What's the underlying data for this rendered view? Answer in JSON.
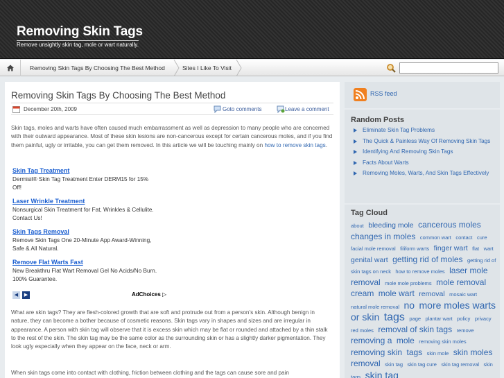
{
  "header": {
    "site_title": "Removing Skin Tags",
    "site_description": "Remove unsightly skin tag, mole or wart naturally."
  },
  "nav": {
    "home_icon": "home-icon",
    "items": [
      {
        "label": "Removing Skin Tags By Choosing The Best Method"
      },
      {
        "label": "Sites I Like To Visit"
      }
    ],
    "search_icon": "magnifier-icon",
    "search_value": ""
  },
  "post": {
    "title": "Removing Skin Tags By Choosing The Best Method",
    "date": "December 20th, 2009",
    "goto_comments": "Goto comments",
    "leave_comment": "Leave a comment",
    "intro_text": "Skin tags, moles and warts have often caused much embarrassment as well as depression to many people who are concerned with their outward appearance. Most of these skin lesions are non-cancerous except for certain cancerous moles, and if you find them painful, ugly or irritable, you can get them removed. In this article we will be touching mainly on",
    "intro_link": "how to remove skin tags",
    "intro_end": ".",
    "para2": "What are skin tags? They are flesh-colored growth that are soft and protrude out from a person’s skin. Although benign in nature, they can become a bother because of cosmetic reasons. Skin tags vary in shapes and sizes and are irregular in appearance. A person with skin tag will observe that it is excess skin which may be flat or rounded and attached by a thin stalk to the rest of the skin. The skin tag may be the same color as the surrounding skin or has a slightly darker pigmentation. They look ugly especially when they appear on the face, neck or arm.",
    "para3": "When skin tags come into contact with clothing, friction between clothing and the tags can cause sore and pain"
  },
  "ads": {
    "items": [
      {
        "title": "Skin Tag Treatment",
        "text": "Dermisil® Skin Tag Treatment Enter DERM15 for 15% Off!"
      },
      {
        "title": "Laser Wrinkle Treatment",
        "text": "Nonsurgical Skin Treatment for Fat, Wrinkles & Cellulite. Contact Us!"
      },
      {
        "title": "Skin Tags Removal",
        "text": "Remove Skin Tags One 20-Minute App Award-Winning, Safe & All Natural."
      },
      {
        "title": "Remove Flat Warts Fast",
        "text": "New Breakthru Flat Wart Removal Gel No Acids/No Burn. 100% Guarantee."
      }
    ],
    "adchoices_label": "AdChoices"
  },
  "sidebar": {
    "rss_label": "RSS feed",
    "random_posts_title": "Random Posts",
    "random_posts": [
      "Eliminate Skin Tag Problems",
      "The Quick & Painless Way Of Removing Skin Tags",
      "Identifying And Removing Skin Tags",
      "Facts About Warts",
      "Removing Moles, Warts, And Skin Tags Effectively"
    ],
    "tag_cloud_title": "Tag Cloud",
    "tags": [
      {
        "t": "about",
        "s": 1
      },
      {
        "t": "bleeding mole",
        "s": 3
      },
      {
        "t": "cancerous moles",
        "s": 4
      },
      {
        "t": "changes in moles",
        "s": 4
      },
      {
        "t": "common wart",
        "s": 1
      },
      {
        "t": "contact",
        "s": 1
      },
      {
        "t": "cure",
        "s": 1
      },
      {
        "t": "facial mole removal",
        "s": 1
      },
      {
        "t": "filiform warts",
        "s": 1
      },
      {
        "t": "finger wart",
        "s": 3
      },
      {
        "t": "flat",
        "s": 1
      },
      {
        "t": "wart",
        "s": 1
      },
      {
        "t": "genital wart",
        "s": 3
      },
      {
        "t": "getting rid of moles",
        "s": 4
      },
      {
        "t": "getting rid of skin tags on neck",
        "s": 1
      },
      {
        "t": "how to remove moles",
        "s": 1
      },
      {
        "t": "laser mole removal",
        "s": 4
      },
      {
        "t": "mole mole problems",
        "s": 1
      },
      {
        "t": "mole removal cream",
        "s": 4
      },
      {
        "t": "mole wart",
        "s": 4
      },
      {
        "t": "removal",
        "s": 3
      },
      {
        "t": "mosaic wart",
        "s": 1
      },
      {
        "t": "natural mole removal",
        "s": 1
      },
      {
        "t": "no",
        "s": 5
      },
      {
        "t": "more moles warts or skin",
        "s": 5
      },
      {
        "t": "tags",
        "s": 6
      },
      {
        "t": "page",
        "s": 1
      },
      {
        "t": "plantar wart",
        "s": 1
      },
      {
        "t": "policy",
        "s": 1
      },
      {
        "t": "privacy",
        "s": 1
      },
      {
        "t": "red moles",
        "s": 1
      },
      {
        "t": "removal of skin tags",
        "s": 4
      },
      {
        "t": "remove",
        "s": 1
      },
      {
        "t": "removing a",
        "s": 4
      },
      {
        "t": "mole",
        "s": 4
      },
      {
        "t": "removing skin moles",
        "s": 1
      },
      {
        "t": "removing skin",
        "s": 4
      },
      {
        "t": "tags",
        "s": 4
      },
      {
        "t": "skin mole",
        "s": 1
      },
      {
        "t": "skin moles removal",
        "s": 4
      },
      {
        "t": "skin tag",
        "s": 1
      },
      {
        "t": "skin tag cure",
        "s": 1
      },
      {
        "t": "skin tag removal",
        "s": 1
      },
      {
        "t": "skin tags",
        "s": 1
      },
      {
        "t": "skin tag",
        "s": 5
      }
    ]
  },
  "colors": {
    "link": "#2f66b0",
    "header_bg": "#2a2a2a",
    "ad_link": "#1a5ed0",
    "rss": "#f08020"
  }
}
